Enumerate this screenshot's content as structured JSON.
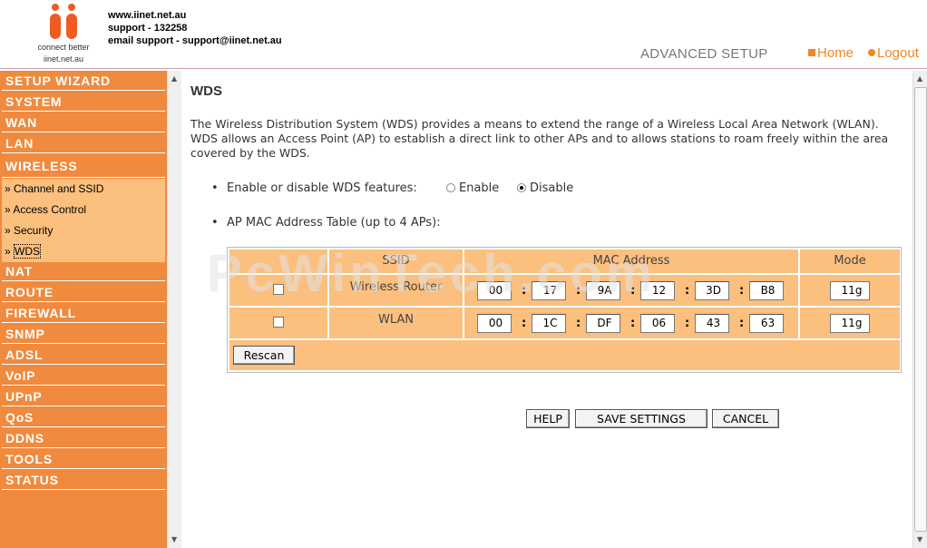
{
  "header": {
    "logo_tagline": "connect better",
    "logo_url": "iinet.net.au",
    "contact_lines": [
      "www.iinet.net.au",
      "support - 132258",
      "email support - support@iinet.net.au"
    ],
    "section_title": "ADVANCED SETUP",
    "home_label": "Home",
    "logout_label": "Logout"
  },
  "sidebar": {
    "items": [
      {
        "label": "SETUP WIZARD"
      },
      {
        "label": "SYSTEM"
      },
      {
        "label": "WAN"
      },
      {
        "label": "LAN"
      },
      {
        "label": "WIRELESS"
      }
    ],
    "subitems": [
      {
        "label": "» Channel and SSID"
      },
      {
        "label": "» Access Control"
      },
      {
        "label": "» Security"
      },
      {
        "label": "WDS",
        "prefix": "» "
      }
    ],
    "items_after": [
      {
        "label": "NAT"
      },
      {
        "label": "ROUTE"
      },
      {
        "label": "FIREWALL"
      },
      {
        "label": "SNMP"
      },
      {
        "label": "ADSL"
      },
      {
        "label": "VoIP"
      },
      {
        "label": "UPnP"
      },
      {
        "label": "QoS"
      },
      {
        "label": "DDNS"
      },
      {
        "label": "TOOLS"
      },
      {
        "label": "STATUS"
      }
    ]
  },
  "main": {
    "title": "WDS",
    "description": "The Wireless Distribution System (WDS) provides a means to extend the range of a Wireless Local Area Network (WLAN). WDS allows an Access Point (AP) to establish a direct link to other APs and to allows stations to roam freely within the area covered by the WDS.",
    "enable_label": "Enable or disable WDS features:",
    "enable_option": "Enable",
    "disable_option": "Disable",
    "selected": "Disable",
    "table_label": "AP MAC Address Table (up to 4 APs):",
    "table": {
      "headers": [
        "SSID",
        "MAC Address",
        "Mode"
      ],
      "rows": [
        {
          "checked": false,
          "ssid": "Wireless Router",
          "mac": [
            "00",
            "17",
            "9A",
            "12",
            "3D",
            "B8"
          ],
          "mode": "11g"
        },
        {
          "checked": false,
          "ssid": "WLAN",
          "mac": [
            "00",
            "1C",
            "DF",
            "06",
            "43",
            "63"
          ],
          "mode": "11g"
        }
      ],
      "rescan_label": "Rescan"
    },
    "buttons": {
      "help": "HELP",
      "save": "SAVE SETTINGS",
      "cancel": "CANCEL"
    },
    "watermark": "PcWinTech.com"
  },
  "colors": {
    "accent": "#f08a3e",
    "light_accent": "#fbbf7e"
  }
}
